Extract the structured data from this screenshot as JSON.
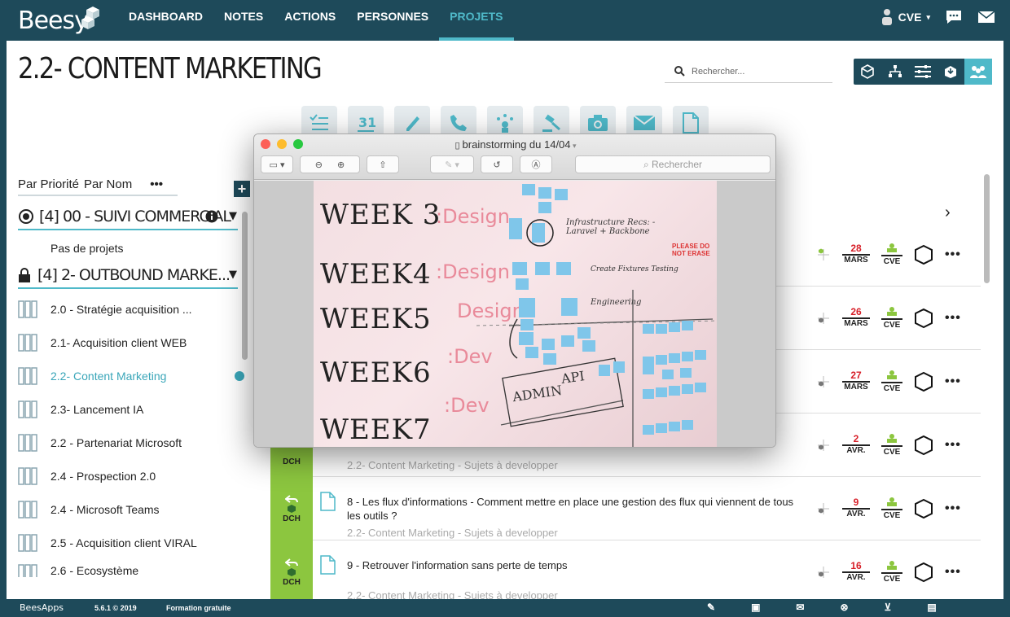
{
  "app": {
    "logo": "Beesy"
  },
  "nav": {
    "items": [
      "DASHBOARD",
      "NOTES",
      "ACTIONS",
      "PERSONNES",
      "PROJETS"
    ],
    "active": "PROJETS"
  },
  "user": {
    "name": "CVE"
  },
  "page": {
    "title": "2.2- CONTENT MARKETING"
  },
  "search": {
    "placeholder": "Rechercher..."
  },
  "sort": {
    "priority": "Par Priorité",
    "name": "Par Nom",
    "more": "•••"
  },
  "groups": [
    {
      "label": "[4] 00 - SUIVI COMMERCIAL",
      "empty": "Pas de projets"
    },
    {
      "label": "[4] 2- OUTBOUND MARKE..."
    }
  ],
  "projects": [
    "2.0 - Stratégie acquisition ...",
    "2.1- Acquisition client WEB",
    "2.2- Content Marketing",
    "2.3- Lancement IA",
    "2.2 - Partenariat Microsoft",
    "2.4 - Prospection 2.0",
    "2.4 - Microsoft Teams",
    "2.5 - Acquisition client VIRAL",
    "2.6 - Ecosystème"
  ],
  "active_project": "2.2- Content Marketing",
  "rows": [
    {
      "day": "28",
      "month": "MARS",
      "owner": "CVE"
    },
    {
      "day": "26",
      "month": "MARS",
      "owner": "CVE"
    },
    {
      "day": "27",
      "month": "MARS",
      "owner": "CVE"
    },
    {
      "day": "2",
      "month": "AVR.",
      "owner": "CVE",
      "tag": "DCH",
      "sub": "2.2- Content Marketing - Sujets à developper"
    },
    {
      "day": "9",
      "month": "AVR.",
      "owner": "CVE",
      "tag": "DCH",
      "title": "8 - Les flux d'informations - Comment mettre en place une gestion des flux qui viennent de tous les outils ?",
      "sub": "2.2- Content Marketing - Sujets à developper"
    },
    {
      "day": "16",
      "month": "AVR.",
      "owner": "CVE",
      "tag": "DCH",
      "title": "9 - Retrouver l'information sans perte de temps",
      "sub": "2.2- Content Marketing - Sujets à developper"
    }
  ],
  "popup": {
    "title": "brainstorming du 14/04",
    "search_placeholder": "Rechercher",
    "whiteboard": {
      "weeks": [
        "WEEK 3",
        "WEEK4",
        "WEEK5",
        "WEEK6",
        "WEEK7"
      ],
      "labels": [
        ":Design",
        ":Design",
        "Design",
        ":Dev",
        ":Dev"
      ],
      "notes": [
        "Infrastructure Recs: - Laravel + Backbone",
        "Create Fixtures Testing",
        "Engineering",
        "ADMIN",
        "API",
        "PLEASE DO NOT ERASE"
      ]
    }
  },
  "footer": {
    "brand": "BeesApps",
    "version": "5.6.1 © 2019",
    "training": "Formation gratuite"
  },
  "colors": {
    "bar": "#1e4a5a",
    "accent": "#4fb9c9",
    "tag": "#8cc63f",
    "date": "#d71f28"
  }
}
